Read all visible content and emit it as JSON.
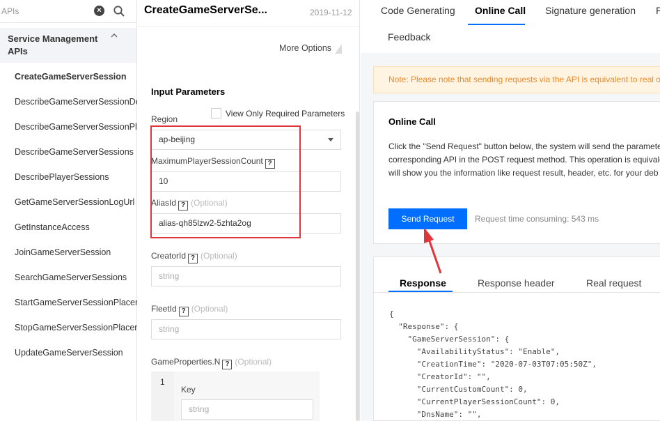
{
  "sidebar": {
    "search_placeholder": "APIs",
    "clear_icon": "×",
    "group_title": "Service Management APIs",
    "items": [
      {
        "label": "CreateGameServerSession",
        "active": true
      },
      {
        "label": "DescribeGameServerSessionDeta"
      },
      {
        "label": "DescribeGameServerSessionPlace"
      },
      {
        "label": "DescribeGameServerSessions"
      },
      {
        "label": "DescribePlayerSessions"
      },
      {
        "label": "GetGameServerSessionLogUrl"
      },
      {
        "label": "GetInstanceAccess"
      },
      {
        "label": "JoinGameServerSession"
      },
      {
        "label": "SearchGameServerSessions"
      },
      {
        "label": "StartGameServerSessionPlacemer"
      },
      {
        "label": "StopGameServerSessionPlacemer"
      },
      {
        "label": "UpdateGameServerSession"
      }
    ]
  },
  "params": {
    "api_title": "CreateGameServerSe...",
    "date": "2019-11-12",
    "more_options": "More Options",
    "input_heading": "Input Parameters",
    "required_only_label": "View Only Required Parameters",
    "help_glyph": "?",
    "fields": {
      "region": {
        "label": "Region",
        "value": "ap-beijing"
      },
      "max_players": {
        "label": "MaximumPlayerSessionCount",
        "value": "10"
      },
      "alias_id": {
        "label": "AliasId",
        "optional": "(Optional)",
        "value": "alias-qh85lzw2-5zhta2og"
      },
      "creator_id": {
        "label": "CreatorId",
        "optional": "(Optional)",
        "placeholder": "string"
      },
      "fleet_id": {
        "label": "FleetId",
        "optional": "(Optional)",
        "placeholder": "string"
      },
      "game_properties": {
        "label": "GameProperties.N",
        "optional": "(Optional)",
        "index": "1",
        "key_label": "Key",
        "key_placeholder": "string"
      }
    }
  },
  "right": {
    "tabs": [
      "Code Generating",
      "Online Call",
      "Signature generation",
      "F",
      "Feedback"
    ],
    "active_tab": "Online Call",
    "note": "Note: Please note that sending requests via the API is equivalent to real op",
    "call_title": "Online Call",
    "call_desc": [
      "Click the \"Send Request\" button below, the system will send the paramete",
      "corresponding API in the POST request method. This operation is equivale",
      "will show you the information like request result, header, etc. for your deb"
    ],
    "send_button": "Send Request",
    "request_time": "Request time consuming: 543 ms",
    "response_tabs": [
      "Response",
      "Response header",
      "Real request"
    ],
    "response_json": [
      "{",
      "  \"Response\": {",
      "    \"GameServerSession\": {",
      "      \"AvailabilityStatus\": \"Enable\",",
      "      \"CreationTime\": \"2020-07-03T07:05:50Z\",",
      "      \"CreatorId\": \"\",",
      "      \"CurrentCustomCount\": 0,",
      "      \"CurrentPlayerSessionCount\": 0,",
      "      \"DnsName\": \"\","
    ]
  },
  "colors": {
    "accent": "#006eff",
    "highlight_frame": "#e0353b",
    "arrow": "#e0353b",
    "note_text": "#e98b2e"
  }
}
